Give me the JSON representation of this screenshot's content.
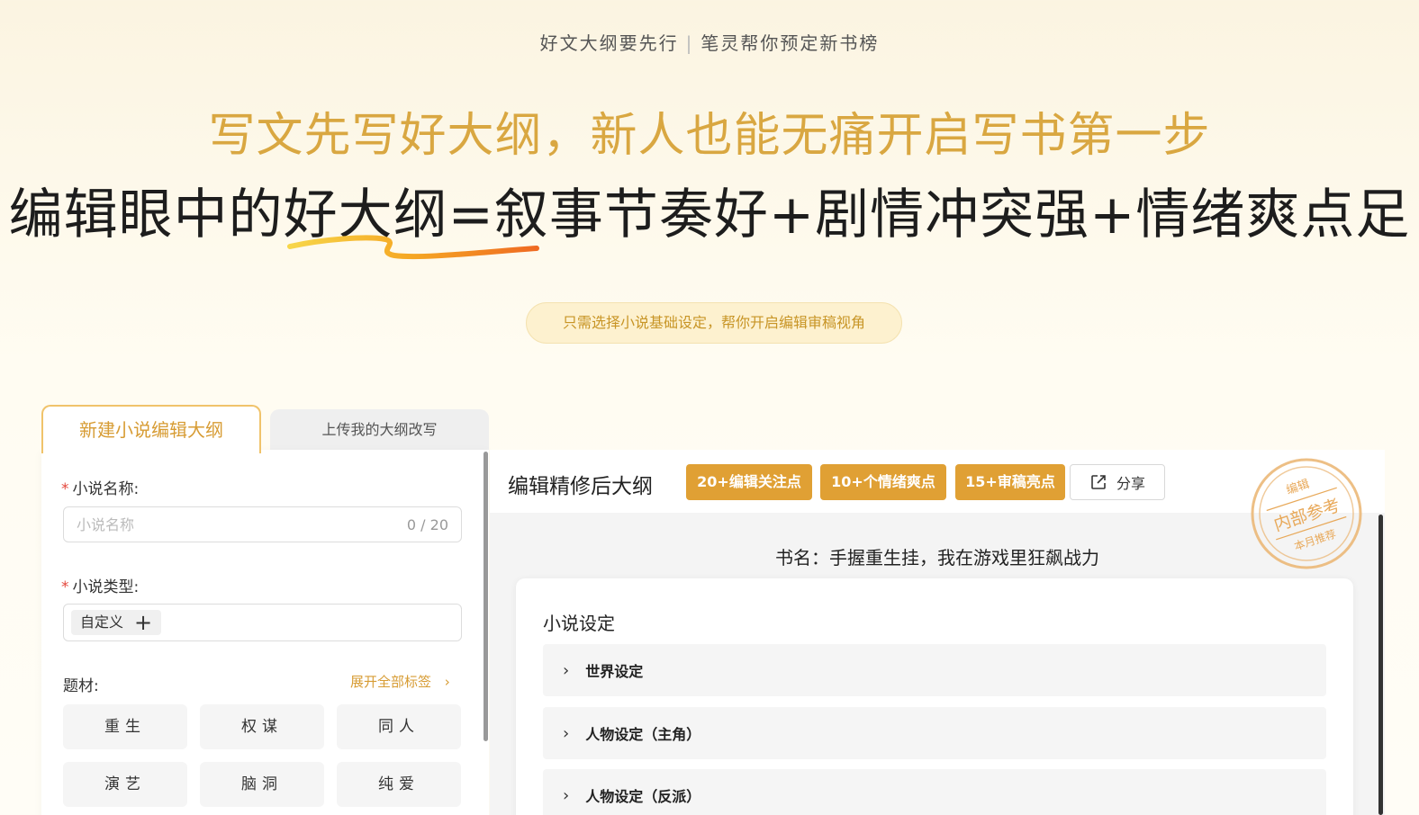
{
  "hero": {
    "tagline_left": "好文大纲要先行",
    "tagline_sep": "|",
    "tagline_right": "笔灵帮你预定新书榜",
    "headline_gold": "写文先写好大纲，新人也能无痛开启写书第一步",
    "headline_black": "编辑眼中的好大纲=叙事节奏好+剧情冲突强+情绪爽点足",
    "pill": "只需选择小说基础设定，帮你开启编辑审稿视角"
  },
  "tabs": {
    "active": "新建小说编辑大纲",
    "inactive": "上传我的大纲改写"
  },
  "form": {
    "name_label": "小说名称:",
    "name_placeholder": "小说名称",
    "name_counter": "0 / 20",
    "type_label": "小说类型:",
    "type_chip": "自定义",
    "subject_label": "题材:",
    "expand_all": "展开全部标签",
    "tags": [
      "重生",
      "权谋",
      "同人",
      "演艺",
      "脑洞",
      "纯爱"
    ]
  },
  "preview": {
    "title": "编辑精修后大纲",
    "badges": [
      "20+编辑关注点",
      "10+个情绪爽点",
      "15+审稿亮点"
    ],
    "share": "分享",
    "book_name": "书名：手握重生挂，我在游戏里狂飙战力",
    "section_title": "小说设定",
    "sections": [
      "世界设定",
      "人物设定（主角）",
      "人物设定（反派）"
    ]
  },
  "stamp": {
    "top": "编辑",
    "middle": "内部参考",
    "bottom": "本月推荐"
  },
  "colors": {
    "gold": "#d9a741",
    "badge": "#e0a034",
    "stamp": "#eab470"
  }
}
